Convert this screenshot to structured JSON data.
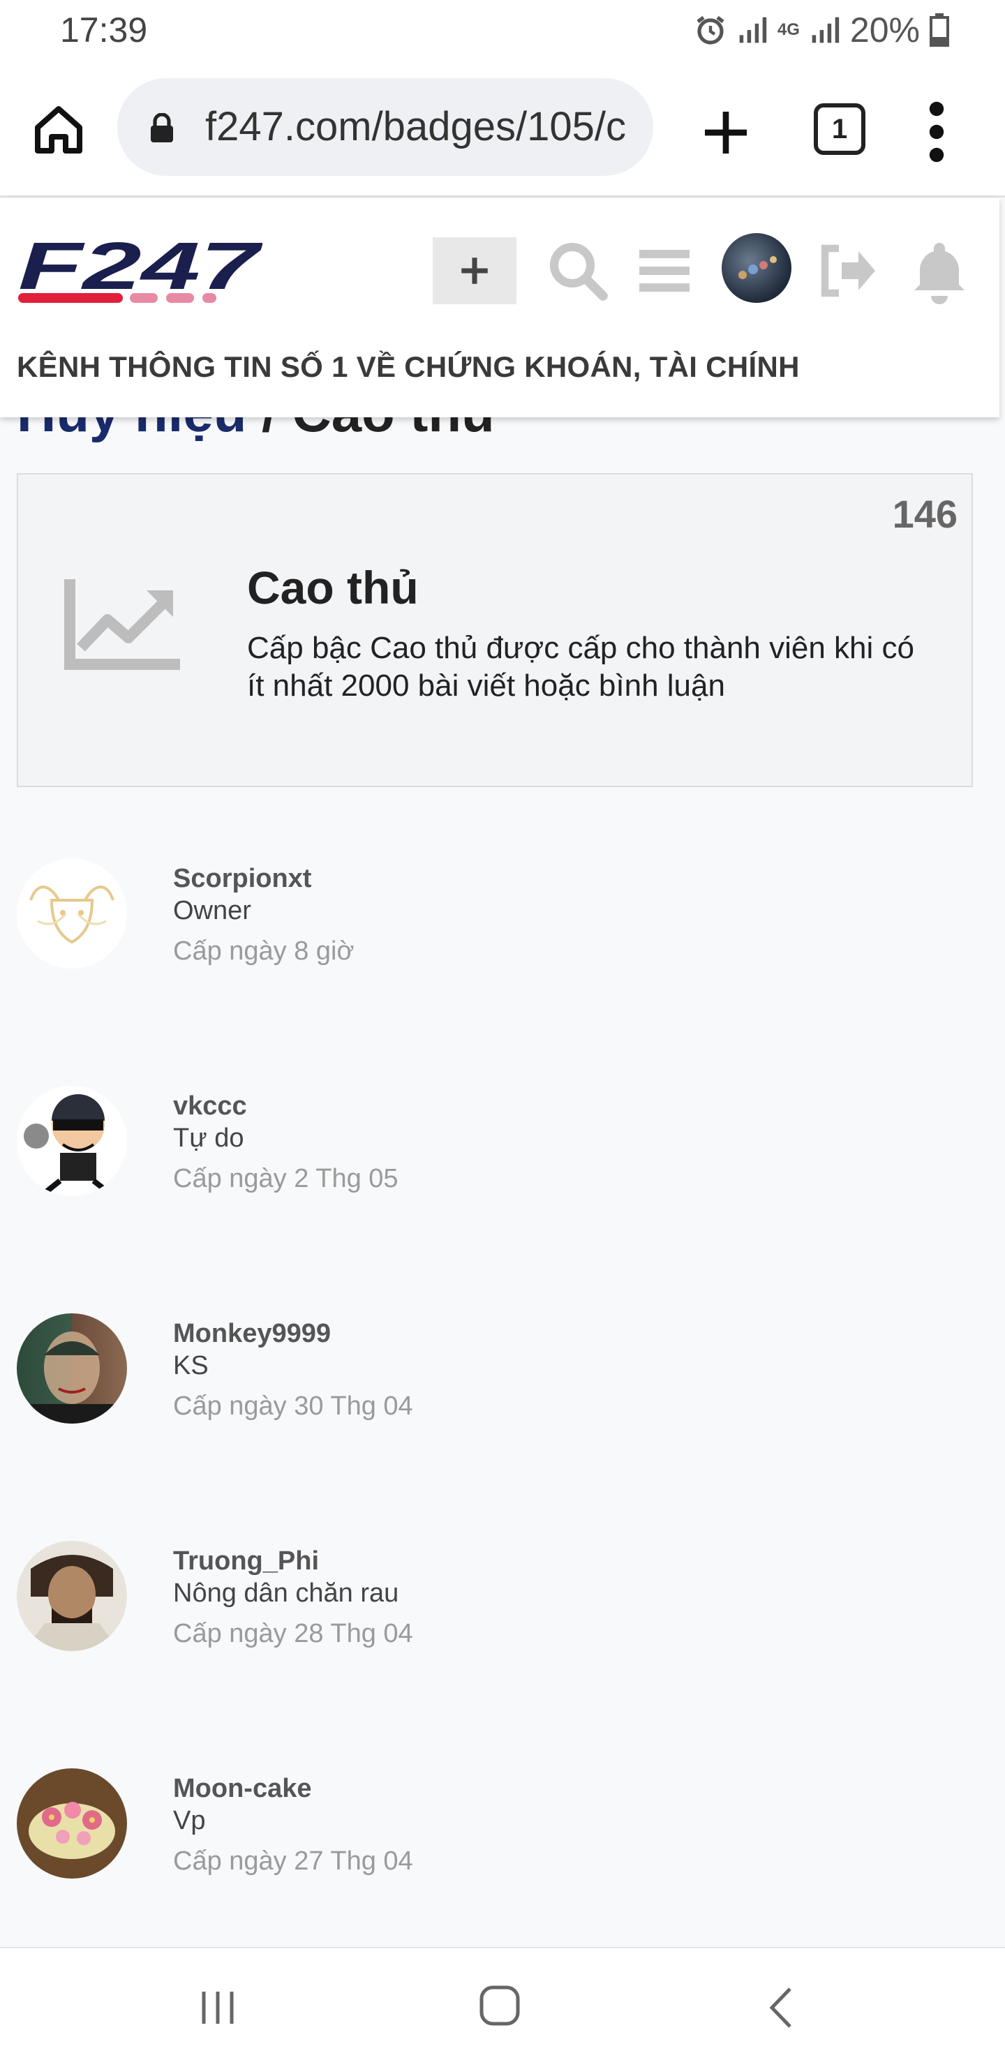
{
  "status_bar": {
    "time": "17:39",
    "network": "4G",
    "battery": "20%",
    "icons": [
      "alarm-icon",
      "signal-icon",
      "data-arrows-icon",
      "battery-icon"
    ]
  },
  "browser": {
    "url": "f247.com/badges/105/c",
    "tab_count": "1",
    "icons": [
      "home-icon",
      "lock-icon",
      "new-tab-icon",
      "tab-switcher-icon",
      "overflow-menu-icon"
    ]
  },
  "site": {
    "logo_text": "F247",
    "tagline": "KÊNH THÔNG TIN SỐ 1 VỀ CHỨNG KHOÁN, TÀI CHÍNH",
    "header_icons": [
      "plus-icon",
      "search-icon",
      "hamburger-icon",
      "user-avatar",
      "logout-icon",
      "bell-icon"
    ],
    "breadcrumb_peek": {
      "parent": "Huy hiệu",
      "separator": "/",
      "current": "Cao thủ"
    }
  },
  "badge": {
    "count": "146",
    "title": "Cao thủ",
    "description": "Cấp bậc Cao thủ được cấp cho thành viên khi có ít nhất 2000 bài viết hoặc bình luận",
    "icon": "trending-up-icon"
  },
  "members": [
    {
      "name": "Scorpionxt",
      "title": "Owner",
      "granted": "Cấp ngày 8 giờ"
    },
    {
      "name": "vkccc",
      "title": "Tự do",
      "granted": "Cấp ngày 2 Thg 05"
    },
    {
      "name": "Monkey9999",
      "title": "KS",
      "granted": "Cấp ngày 30 Thg 04"
    },
    {
      "name": "Truong_Phi",
      "title": "Nông dân chăn rau",
      "granted": "Cấp ngày 28 Thg 04"
    },
    {
      "name": "Moon-cake",
      "title": "Vp",
      "granted": "Cấp ngày 27 Thg 04"
    }
  ],
  "nav_bar": {
    "icons": [
      "recent-apps-icon",
      "home-nav-icon",
      "back-icon"
    ]
  },
  "colors": {
    "brand_navy": "#1a1f4e",
    "brand_red": "#e0203a",
    "brand_pink": "#e88aa4",
    "link_blue": "#1a2b6b"
  }
}
